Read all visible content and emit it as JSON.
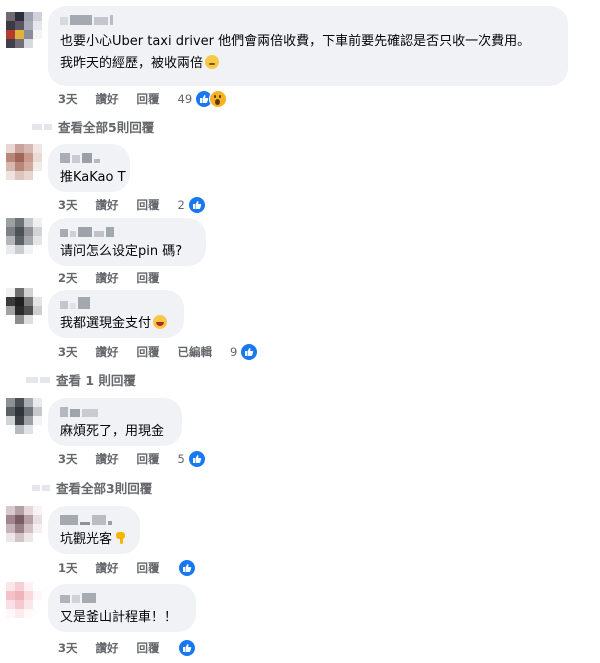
{
  "comments": [
    {
      "text_lines": [
        "也要小心Uber taxi driver 他們會兩倍收費，下車前要先確認是否只收一次費用。",
        "我昨天的經歷，被收兩倍"
      ],
      "emoji": "sweat",
      "time": "3天",
      "like_label": "讚好",
      "reply_label": "回覆",
      "reaction_count": "49",
      "reactions": [
        "like",
        "wow"
      ]
    },
    {
      "text_lines": [
        "推KaKao T"
      ],
      "time": "3天",
      "like_label": "讚好",
      "reply_label": "回覆",
      "reaction_count": "2",
      "reactions": [
        "like"
      ]
    },
    {
      "text_lines": [
        "请问怎么设定pin 碼?"
      ],
      "time": "2天",
      "like_label": "讚好",
      "reply_label": "回覆"
    },
    {
      "text_lines": [
        "我都選現金支付"
      ],
      "emoji": "laugh",
      "time": "3天",
      "like_label": "讚好",
      "reply_label": "回覆",
      "edited_label": "已編輯",
      "reaction_count": "9",
      "reactions": [
        "like"
      ]
    },
    {
      "text_lines": [
        "麻煩死了，用現金"
      ],
      "time": "3天",
      "like_label": "讚好",
      "reply_label": "回覆",
      "reaction_count": "5",
      "reactions": [
        "like"
      ]
    },
    {
      "text_lines": [
        "坑觀光客"
      ],
      "emoji": "thumbdown",
      "time": "1天",
      "like_label": "讚好",
      "reply_label": "回覆",
      "reactions": [
        "like"
      ]
    },
    {
      "text_lines": [
        "又是釜山計程車！！"
      ],
      "time": "3天",
      "like_label": "讚好",
      "reply_label": "回覆",
      "reactions": [
        "like"
      ]
    }
  ],
  "view_replies": [
    "查看全部5則回覆",
    "查看 1 則回覆",
    "查看全部3則回覆"
  ],
  "colors": {
    "bubble": "#f0f2f5",
    "meta_text": "#65676b",
    "like_blue": "#1877f2"
  }
}
